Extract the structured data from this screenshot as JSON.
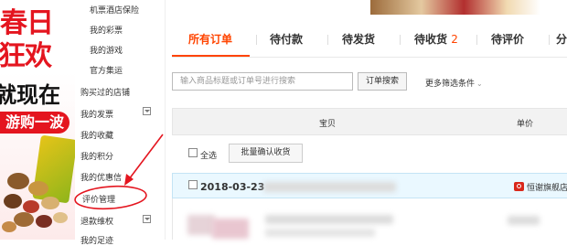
{
  "promo": {
    "line1": "春日",
    "line2": "狂欢",
    "line3": "就现在",
    "pill": "游购一波"
  },
  "sidebar": {
    "items": [
      {
        "label": "机票酒店保险"
      },
      {
        "label": "我的彩票"
      },
      {
        "label": "我的游戏"
      },
      {
        "label": "官方集运"
      },
      {
        "label": "购买过的店铺"
      },
      {
        "label": "我的发票"
      },
      {
        "label": "我的收藏"
      },
      {
        "label": "我的积分"
      },
      {
        "label": "我的优惠信"
      },
      {
        "label": "评价管理"
      },
      {
        "label": "退款维权"
      },
      {
        "label": "我的足迹"
      }
    ]
  },
  "tabs": [
    {
      "label": "所有订单"
    },
    {
      "label": "待付款"
    },
    {
      "label": "待发货"
    },
    {
      "label": "待收货",
      "count": "2"
    },
    {
      "label": "待评价"
    },
    {
      "label": "分"
    }
  ],
  "search": {
    "placeholder": "输入商品标题或订单号进行搜索",
    "button": "订单搜索",
    "more_filters": "更多筛选条件"
  },
  "table": {
    "columns": [
      "宝贝",
      "单价"
    ]
  },
  "batch": {
    "select_all": "全选",
    "confirm_button": "批量确认收货"
  },
  "order": {
    "date": "2018-03-23",
    "shop_name": "恒谢旗舰店"
  },
  "colors": {
    "accent": "#ff4400",
    "annotation": "#e4151f",
    "order_header_bg": "#eaf8ff"
  }
}
